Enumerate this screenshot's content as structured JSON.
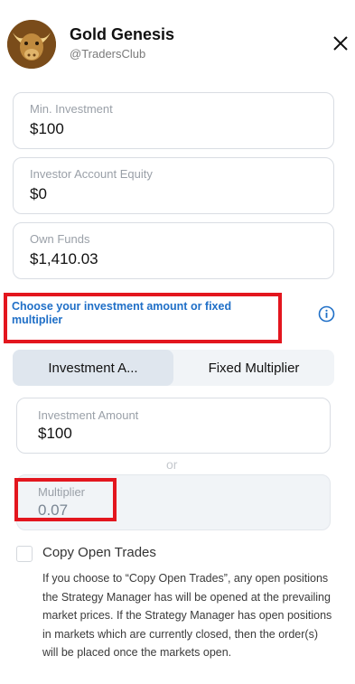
{
  "header": {
    "title": "Gold Genesis",
    "handle": "@TradersClub",
    "avatar_icon": "bull-icon",
    "close_icon": "close-icon"
  },
  "fields": {
    "min_investment": {
      "label": "Min. Investment",
      "value": "$100"
    },
    "investor_equity": {
      "label": "Investor Account Equity",
      "value": "$0"
    },
    "own_funds": {
      "label": "Own Funds",
      "value": "$1,410.03"
    }
  },
  "choose": {
    "prefix": "Choose your ",
    "emphasis": "investment amount or fixed multiplier",
    "info_icon": "info-icon"
  },
  "toggle": {
    "tabs": [
      {
        "label": "Investment A...",
        "active": true
      },
      {
        "label": "Fixed Multiplier",
        "active": false
      }
    ]
  },
  "investment_amount": {
    "label": "Investment Amount",
    "value": "$100"
  },
  "or_label": "or",
  "multiplier": {
    "label": "Multiplier",
    "value": "0.07"
  },
  "copy_trades": {
    "label": "Copy Open Trades",
    "checked": false,
    "description": "If you choose to “Copy Open Trades”, any open positions the Strategy Manager has will be opened at the prevailing market prices. If the Strategy Manager has open positions in markets which are currently closed, then the order(s) will be placed once the markets open."
  },
  "colors": {
    "accent": "#1f6fc7",
    "highlight": "#e3161e"
  }
}
